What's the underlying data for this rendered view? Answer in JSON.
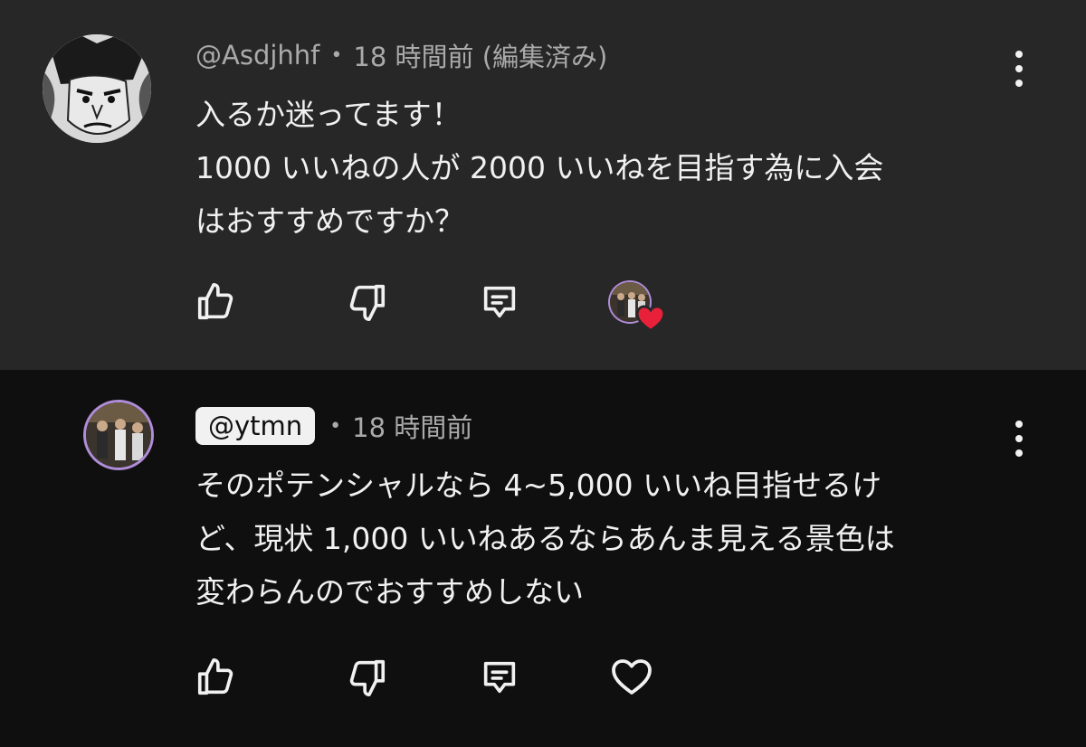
{
  "comments": [
    {
      "author": "@Asdjhhf",
      "separator": "•",
      "time": "18 時間前 (編集済み)",
      "lines": [
        "入るか迷ってます！",
        "1000 いいねの人が 2000 いいねを目指す為に入会",
        "はおすすめですか？"
      ],
      "hearted_by_creator": true
    },
    {
      "author": "@ytmn",
      "author_is_creator": true,
      "separator": "•",
      "time": "18 時間前",
      "lines": [
        "そのポテンシャルなら 4~5,000 いいね目指せるけ",
        "ど、現状 1,000 いいねあるならあんま見える景色は",
        "変わらんのでおすすめしない"
      ],
      "hearted_by_creator": false
    }
  ],
  "icons": {
    "like": "thumbs-up-icon",
    "dislike": "thumbs-down-icon",
    "reply": "comment-icon",
    "heart": "heart-icon",
    "more": "more-vertical-icon"
  },
  "colors": {
    "heart_red": "#e8203a",
    "creator_ring": "#b08dd8"
  }
}
